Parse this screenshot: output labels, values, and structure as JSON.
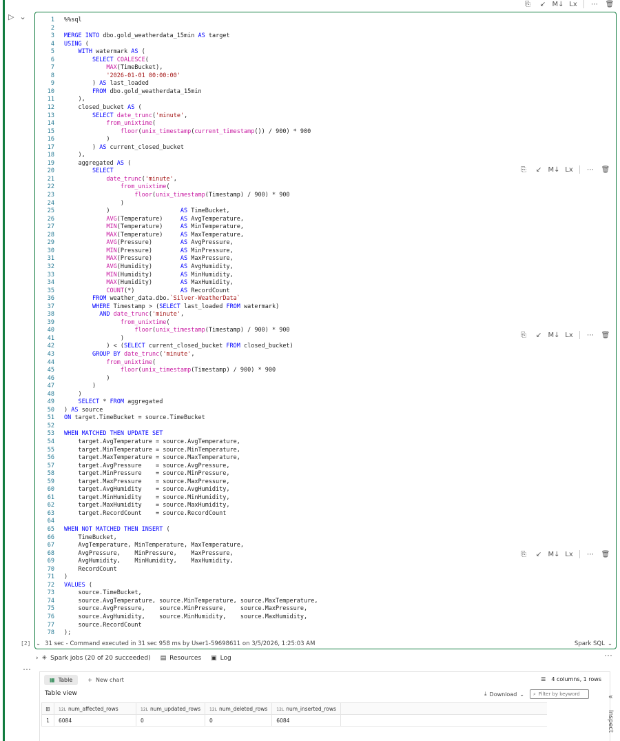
{
  "editor": {
    "lines": [
      {
        "n": "1",
        "t": "%%sql"
      },
      {
        "n": "2",
        "t": ""
      },
      {
        "n": "3",
        "t": "MERGE INTO dbo.gold_weatherdata_15min AS target"
      },
      {
        "n": "4",
        "t": "USING ("
      },
      {
        "n": "5",
        "t": "    WITH watermark AS ("
      },
      {
        "n": "6",
        "t": "        SELECT COALESCE("
      },
      {
        "n": "7",
        "t": "            MAX(TimeBucket),"
      },
      {
        "n": "8",
        "t": "            '2026-01-01 00:00:00'"
      },
      {
        "n": "9",
        "t": "        ) AS last_loaded"
      },
      {
        "n": "10",
        "t": "        FROM dbo.gold_weatherdata_15min"
      },
      {
        "n": "11",
        "t": "    ),"
      },
      {
        "n": "12",
        "t": "    closed_bucket AS ("
      },
      {
        "n": "13",
        "t": "        SELECT date_trunc('minute',"
      },
      {
        "n": "14",
        "t": "            from_unixtime("
      },
      {
        "n": "15",
        "t": "                floor(unix_timestamp(current_timestamp()) / 900) * 900"
      },
      {
        "n": "16",
        "t": "            )"
      },
      {
        "n": "17",
        "t": "        ) AS current_closed_bucket"
      },
      {
        "n": "18",
        "t": "    ),"
      },
      {
        "n": "19",
        "t": "    aggregated AS ("
      },
      {
        "n": "20",
        "t": "        SELECT"
      },
      {
        "n": "21",
        "t": "            date_trunc('minute',"
      },
      {
        "n": "22",
        "t": "                from_unixtime("
      },
      {
        "n": "23",
        "t": "                    floor(unix_timestamp(Timestamp) / 900) * 900"
      },
      {
        "n": "24",
        "t": "                )"
      },
      {
        "n": "25",
        "t": "            )                    AS TimeBucket,"
      },
      {
        "n": "26",
        "t": "            AVG(Temperature)     AS AvgTemperature,"
      },
      {
        "n": "27",
        "t": "            MIN(Temperature)     AS MinTemperature,"
      },
      {
        "n": "28",
        "t": "            MAX(Temperature)     AS MaxTemperature,"
      },
      {
        "n": "29",
        "t": "            AVG(Pressure)        AS AvgPressure,"
      },
      {
        "n": "30",
        "t": "            MIN(Pressure)        AS MinPressure,"
      },
      {
        "n": "31",
        "t": "            MAX(Pressure)        AS MaxPressure,"
      },
      {
        "n": "32",
        "t": "            AVG(Humidity)        AS AvgHumidity,"
      },
      {
        "n": "33",
        "t": "            MIN(Humidity)        AS MinHumidity,"
      },
      {
        "n": "34",
        "t": "            MAX(Humidity)        AS MaxHumidity,"
      },
      {
        "n": "35",
        "t": "            COUNT(*)             AS RecordCount"
      },
      {
        "n": "36",
        "t": "        FROM weather_data.dbo.`Silver-WeatherData`"
      },
      {
        "n": "37",
        "t": "        WHERE Timestamp > (SELECT last_loaded FROM watermark)"
      },
      {
        "n": "38",
        "t": "          AND date_trunc('minute',"
      },
      {
        "n": "39",
        "t": "                from_unixtime("
      },
      {
        "n": "40",
        "t": "                    floor(unix_timestamp(Timestamp) / 900) * 900"
      },
      {
        "n": "41",
        "t": "                )"
      },
      {
        "n": "42",
        "t": "            ) < (SELECT current_closed_bucket FROM closed_bucket)"
      },
      {
        "n": "43",
        "t": "        GROUP BY date_trunc('minute',"
      },
      {
        "n": "44",
        "t": "            from_unixtime("
      },
      {
        "n": "45",
        "t": "                floor(unix_timestamp(Timestamp) / 900) * 900"
      },
      {
        "n": "46",
        "t": "            )"
      },
      {
        "n": "47",
        "t": "        )"
      },
      {
        "n": "48",
        "t": "    )"
      },
      {
        "n": "49",
        "t": "    SELECT * FROM aggregated"
      },
      {
        "n": "50",
        "t": ") AS source"
      },
      {
        "n": "51",
        "t": "ON target.TimeBucket = source.TimeBucket"
      },
      {
        "n": "52",
        "t": ""
      },
      {
        "n": "53",
        "t": "WHEN MATCHED THEN UPDATE SET"
      },
      {
        "n": "54",
        "t": "    target.AvgTemperature = source.AvgTemperature,"
      },
      {
        "n": "55",
        "t": "    target.MinTemperature = source.MinTemperature,"
      },
      {
        "n": "56",
        "t": "    target.MaxTemperature = source.MaxTemperature,"
      },
      {
        "n": "57",
        "t": "    target.AvgPressure    = source.AvgPressure,"
      },
      {
        "n": "58",
        "t": "    target.MinPressure    = source.MinPressure,"
      },
      {
        "n": "59",
        "t": "    target.MaxPressure    = source.MaxPressure,"
      },
      {
        "n": "60",
        "t": "    target.AvgHumidity    = source.AvgHumidity,"
      },
      {
        "n": "61",
        "t": "    target.MinHumidity    = source.MinHumidity,"
      },
      {
        "n": "62",
        "t": "    target.MaxHumidity    = source.MaxHumidity,"
      },
      {
        "n": "63",
        "t": "    target.RecordCount    = source.RecordCount"
      },
      {
        "n": "64",
        "t": ""
      },
      {
        "n": "65",
        "t": "WHEN NOT MATCHED THEN INSERT ("
      },
      {
        "n": "66",
        "t": "    TimeBucket,"
      },
      {
        "n": "67",
        "t": "    AvgTemperature, MinTemperature, MaxTemperature,"
      },
      {
        "n": "68",
        "t": "    AvgPressure,    MinPressure,    MaxPressure,"
      },
      {
        "n": "69",
        "t": "    AvgHumidity,    MinHumidity,    MaxHumidity,"
      },
      {
        "n": "70",
        "t": "    RecordCount"
      },
      {
        "n": "71",
        "t": ")"
      },
      {
        "n": "72",
        "t": "VALUES ("
      },
      {
        "n": "73",
        "t": "    source.TimeBucket,"
      },
      {
        "n": "74",
        "t": "    source.AvgTemperature, source.MinTemperature, source.MaxTemperature,"
      },
      {
        "n": "75",
        "t": "    source.AvgPressure,    source.MinPressure,    source.MaxPressure,"
      },
      {
        "n": "76",
        "t": "    source.AvgHumidity,    source.MinHumidity,    source.MaxHumidity,"
      },
      {
        "n": "77",
        "t": "    source.RecordCount"
      },
      {
        "n": "78",
        "t": ");"
      }
    ]
  },
  "status": {
    "exec_count": "[2]",
    "text": "31 sec - Command executed in 31 sec 958 ms by User1-59698611 on 3/5/2026, 1:25:03 AM",
    "language": "Spark SQL"
  },
  "spark": {
    "jobs": "Spark jobs (20 of 20 succeeded)",
    "resources": "Resources",
    "log": "Log"
  },
  "output": {
    "tab_table": "Table",
    "new_chart": "New chart",
    "col_rows": "4 columns, 1 rows",
    "table_view": "Table view",
    "download": "Download",
    "filter_placeholder": "Filter by keyword",
    "inspect": "Inspect",
    "columns": [
      "num_affected_rows",
      "num_updated_rows",
      "num_deleted_rows",
      "num_inserted_rows"
    ],
    "row_number": "1",
    "row": [
      "6084",
      "0",
      "0",
      "6084"
    ]
  },
  "colors": {
    "accent": "#0f7b3e",
    "line_number": "#237893",
    "keyword": "#0000ff",
    "function": "#c718a0",
    "string": "#a31515"
  }
}
